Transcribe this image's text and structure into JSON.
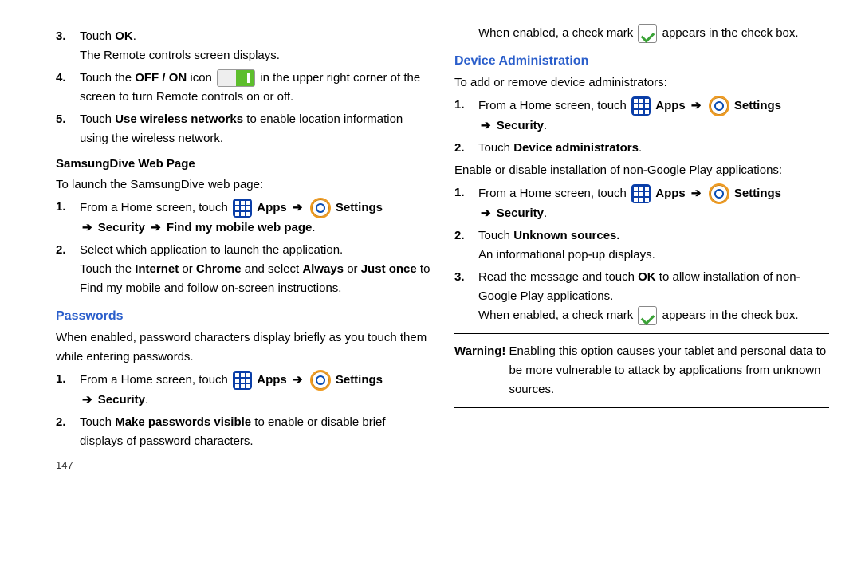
{
  "left": {
    "steps_top": [
      {
        "num": "3.",
        "text_a": "Touch ",
        "bold": "OK",
        "text_b": ".",
        "sub": "The Remote controls screen displays."
      },
      {
        "num": "4.",
        "text_a": "Touch the ",
        "bold": "OFF / ON",
        "text_b": " icon ",
        "text_c": " in the upper right corner of the screen to turn Remote controls on or off.",
        "has_toggle": true
      },
      {
        "num": "5.",
        "text_a": "Touch ",
        "bold": "Use wireless networks",
        "text_b": " to enable location information using the wireless network."
      }
    ],
    "samsungdive_h": "SamsungDive Web Page",
    "samsungdive_intro": "To launch the SamsungDive web page:",
    "sd_steps": [
      {
        "num": "1.",
        "pre": "From a Home screen, touch ",
        "apps": "Apps",
        "settings": "Settings",
        "tail": "Security",
        "tail2": "Find my mobile web page"
      },
      {
        "num": "2.",
        "line1": "Select which application to launch the application.",
        "line2a": "Touch the ",
        "b1": "Internet",
        "line2b": " or ",
        "b2": "Chrome",
        "line2c": "  and select ",
        "b3": "Always",
        "line2d": " or ",
        "b4": "Just once",
        "line2e": " to Find my mobile and follow on-screen instructions."
      }
    ],
    "passwords_h": "Passwords",
    "passwords_intro": "When enabled, password characters display briefly as you touch them while entering passwords.",
    "pw_steps": [
      {
        "num": "1.",
        "pre": "From a Home screen, touch ",
        "apps": "Apps",
        "settings": "Settings",
        "tail": "Security"
      },
      {
        "num": "2.",
        "text_a": "Touch ",
        "bold": "Make passwords visible",
        "text_b": " to enable or disable brief displays of password characters."
      }
    ],
    "page_num": "147"
  },
  "right": {
    "check_text_a": "When enabled, a check mark ",
    "check_text_b": " appears in the check box.",
    "devadmin_h": "Device Administration",
    "devadmin_intro": "To add or remove device administrators:",
    "da_steps": [
      {
        "num": "1.",
        "pre": "From a Home screen, touch ",
        "apps": "Apps",
        "settings": "Settings",
        "tail": "Security"
      },
      {
        "num": "2.",
        "text_a": "Touch ",
        "bold": "Device administrators",
        "text_b": "."
      }
    ],
    "da_mid": "Enable or disable installation of non-Google Play applications:",
    "da_steps2": [
      {
        "num": "1.",
        "pre": "From a Home screen, touch ",
        "apps": "Apps",
        "settings": "Settings",
        "tail": "Security"
      },
      {
        "num": "2.",
        "text_a": "Touch ",
        "bold": "Unknown sources.",
        "text_b": "",
        "sub": "An informational pop-up displays."
      },
      {
        "num": "3.",
        "text_a": "Read the message and touch ",
        "bold": "OK",
        "text_b": " to allow installation of non-Google Play applications.",
        "sub_check_a": "When enabled, a check mark ",
        "sub_check_b": " appears in the check box."
      }
    ],
    "warning_label": "Warning!",
    "warning_text": " Enabling this option causes your tablet and personal data to be more vulnerable to attack by applications from unknown sources."
  }
}
